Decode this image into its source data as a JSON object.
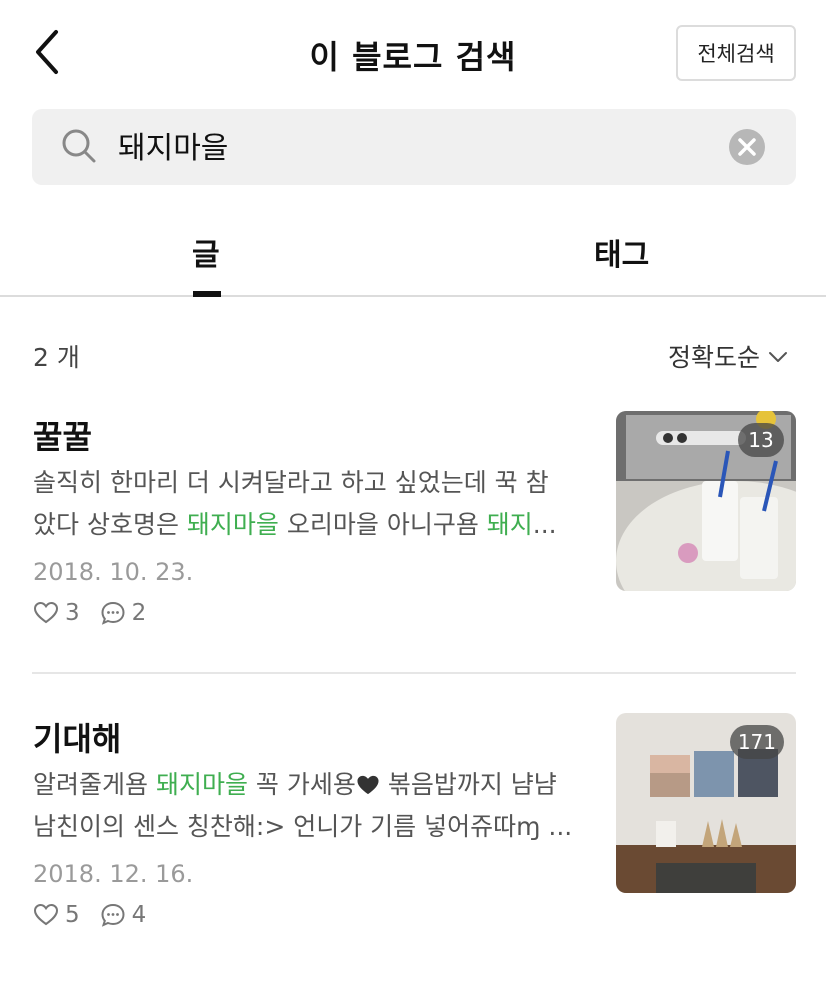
{
  "header": {
    "title": "이 블로그 검색",
    "full_search_label": "전체검색",
    "back_icon": "chevron-left-icon"
  },
  "search": {
    "value": "돼지마을",
    "icon": "search-icon",
    "clear_icon": "clear-icon"
  },
  "tabs": [
    {
      "label": "글",
      "active": true
    },
    {
      "label": "태그",
      "active": false
    }
  ],
  "results": {
    "count": "2 개",
    "sort_label": "정확도순",
    "highlight_color": "#3fae50",
    "items": [
      {
        "title": "꿀꿀",
        "line1_parts": [
          "솔직히 한마리 더 시켜달라고 하고 싶었는데 꾹 참"
        ],
        "line2_a": "았다 상호명은 ",
        "line2_hl1": "돼지마을",
        "line2_b": " 오리마을 아니구욤 ",
        "line2_hl2": "돼지",
        "line2_c": "...",
        "date": "2018. 10. 23.",
        "likes": "3",
        "comments": "2",
        "photo_count": "13"
      },
      {
        "title": "기대해",
        "line1_a": "알려줄게욤 ",
        "line1_hl": "돼지마을",
        "line1_b": " 꼭 가세용",
        "line1_c": " 볶음밥까지 냠냠",
        "line2": "남친이의 센스 칭찬해:> 언니가 기름 넣어쥬따ɱ ...",
        "date": "2018. 12. 16.",
        "likes": "5",
        "comments": "4",
        "photo_count": "171"
      }
    ]
  }
}
